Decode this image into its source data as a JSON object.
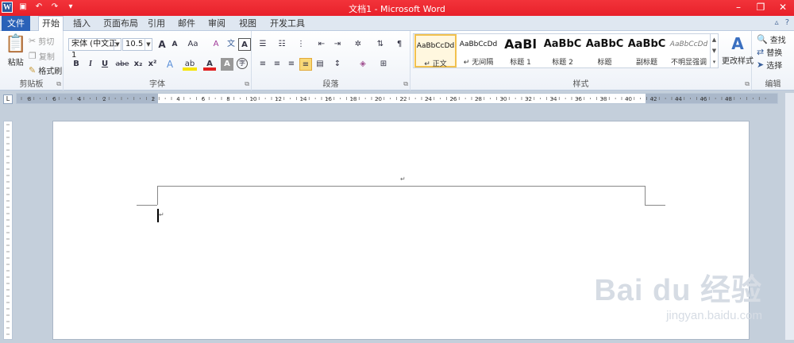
{
  "window": {
    "title": "文档1 - Microsoft Word"
  },
  "qat": {
    "word_icon": "W"
  },
  "tabs": [
    "文件",
    "开始",
    "插入",
    "页面布局",
    "引用",
    "邮件",
    "审阅",
    "视图",
    "开发工具"
  ],
  "clipboard": {
    "paste": "粘贴",
    "cut": "剪切",
    "copy": "复制",
    "format_painter": "格式刷",
    "label": "剪贴板"
  },
  "font": {
    "name": "宋体 (中文正1",
    "size": "10.5",
    "label": "字体",
    "grow": "A",
    "shrink": "A",
    "case": "Aa",
    "clear": "A",
    "bold": "B",
    "italic": "I",
    "underline": "U",
    "strike": "abe",
    "sub": "x₂",
    "sup": "x²",
    "effects": "A",
    "highlight": "ab",
    "color": "A",
    "shade": "A",
    "enclose": "字"
  },
  "paragraph": {
    "label": "段落"
  },
  "styles": {
    "label": "样式",
    "items": [
      {
        "preview": "AaBbCcDd",
        "name": "↵ 正文"
      },
      {
        "preview": "AaBbCcDd",
        "name": "↵ 无间隔"
      },
      {
        "preview": "AaBl",
        "name": "标题 1"
      },
      {
        "preview": "AaBbC",
        "name": "标题 2"
      },
      {
        "preview": "AaBbC",
        "name": "标题"
      },
      {
        "preview": "AaBbC",
        "name": "副标题"
      },
      {
        "preview": "AaBbCcDd",
        "name": "不明显强调"
      }
    ],
    "change": "更改样式"
  },
  "editing": {
    "find": "查找",
    "replace": "替换",
    "select": "选择",
    "label": "编辑"
  },
  "ruler": {
    "labels": [
      "8",
      "6",
      "4",
      "2",
      "2",
      "4",
      "6",
      "8",
      "10",
      "12",
      "14",
      "16",
      "18",
      "20",
      "22",
      "24",
      "26",
      "28",
      "30",
      "32",
      "34",
      "36",
      "38",
      "40",
      "42",
      "44",
      "46",
      "48"
    ]
  },
  "watermark": {
    "brand": "Bai du 经验",
    "url": "jingyan.baidu.com"
  },
  "colors": {
    "title_bar": "#e8202a",
    "file_tab": "#2a62b8",
    "ribbon_bg": "#eef2f8"
  }
}
